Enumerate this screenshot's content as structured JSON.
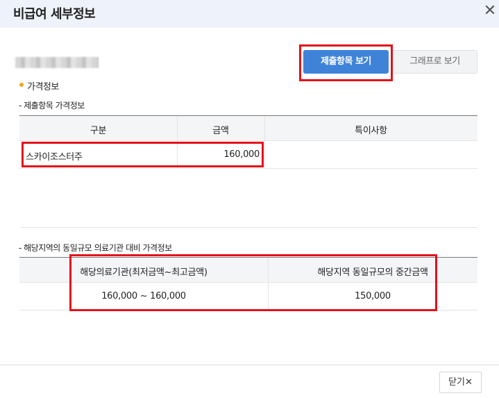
{
  "dialog": {
    "title": "비급여 세부정보",
    "close_icon": "close-icon"
  },
  "buttons": {
    "submitted_items": "제출항목 보기",
    "graph_view": "그래프로 보기",
    "close_label": "닫기",
    "close_symbol": "✕"
  },
  "price_info": {
    "section_title": "가격정보",
    "submitted_table": {
      "caption": "- 제출항목 가격정보",
      "headers": [
        "구분",
        "금액",
        "특이사항"
      ],
      "rows": [
        {
          "category": "스카이조스터주",
          "amount": "160,000",
          "note": ""
        }
      ]
    },
    "regional_table": {
      "caption": "- 해당지역의 동일규모 의료기관 대비 가격정보",
      "headers": [
        "해당의료기관(최저금액~최고금액)",
        "해당지역 동일규모의 중간금액"
      ],
      "rows": [
        {
          "range": "160,000 ~ 160,000",
          "median": "150,000"
        }
      ]
    }
  },
  "colors": {
    "header_bg": "#eef2fa",
    "primary_button": "#3f83d9",
    "highlight_box": "#e3101a",
    "bullet": "#f2a71c"
  }
}
